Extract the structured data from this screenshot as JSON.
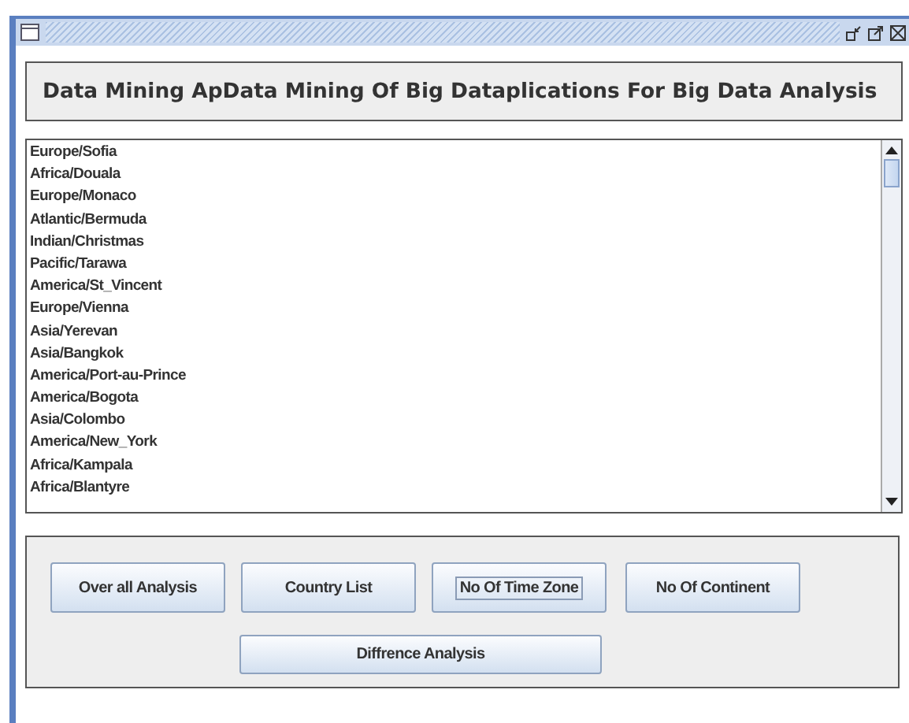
{
  "heading": "Data Mining ApData Mining Of Big Dataplications For Big Data Analysis",
  "list_items": [
    "Europe/Sofia",
    "Africa/Douala",
    "Europe/Monaco",
    "Atlantic/Bermuda",
    "Indian/Christmas",
    "Pacific/Tarawa",
    "America/St_Vincent",
    "Europe/Vienna",
    "Asia/Yerevan",
    "Asia/Bangkok",
    "America/Port-au-Prince",
    "America/Bogota",
    "Asia/Colombo",
    "America/New_York",
    "Africa/Kampala",
    "Africa/Blantyre"
  ],
  "button_rows": [
    [
      {
        "label": "Over all Analysis",
        "focused": false
      },
      {
        "label": "Country List",
        "focused": false
      },
      {
        "label": "No Of Time Zone",
        "focused": true
      },
      {
        "label": "No Of Continent",
        "focused": false
      }
    ],
    [
      {
        "label": "Diffrence Analysis",
        "focused": false
      }
    ]
  ]
}
